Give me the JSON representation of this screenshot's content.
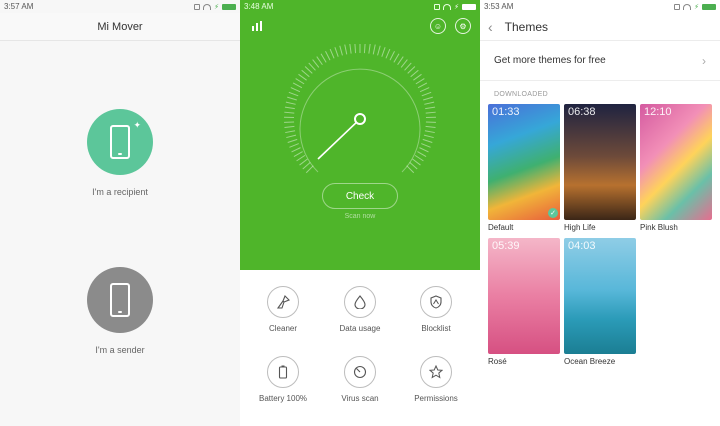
{
  "mover": {
    "status_time": "3:57 AM",
    "title": "Mi Mover",
    "recipient_label": "I'm a recipient",
    "sender_label": "I'm a sender",
    "recipient_color": "#5cc69a",
    "sender_color": "#8b8b8b"
  },
  "security": {
    "status_time": "3:48 AM",
    "accent_color": "#4fb52a",
    "check_label": "Check",
    "scan_label": "Scan now",
    "tools": [
      {
        "label": "Cleaner",
        "icon": "broom-icon"
      },
      {
        "label": "Data usage",
        "icon": "droplet-icon"
      },
      {
        "label": "Blocklist",
        "icon": "shield-block-icon"
      },
      {
        "label": "Battery 100%",
        "icon": "battery-icon"
      },
      {
        "label": "Virus scan",
        "icon": "virus-scan-icon"
      },
      {
        "label": "Permissions",
        "icon": "star-icon"
      }
    ]
  },
  "themes": {
    "status_time": "3:53 AM",
    "title": "Themes",
    "get_more_label": "Get more themes for free",
    "section_label": "DOWNLOADED",
    "items": [
      {
        "name": "Default",
        "time": "01:33",
        "selected": true
      },
      {
        "name": "High Life",
        "time": "06:38",
        "selected": false
      },
      {
        "name": "Pink Blush",
        "time": "12:10",
        "selected": false
      },
      {
        "name": "Rosé",
        "time": "05:39",
        "selected": false
      },
      {
        "name": "Ocean Breeze",
        "time": "04:03",
        "selected": false
      }
    ]
  }
}
